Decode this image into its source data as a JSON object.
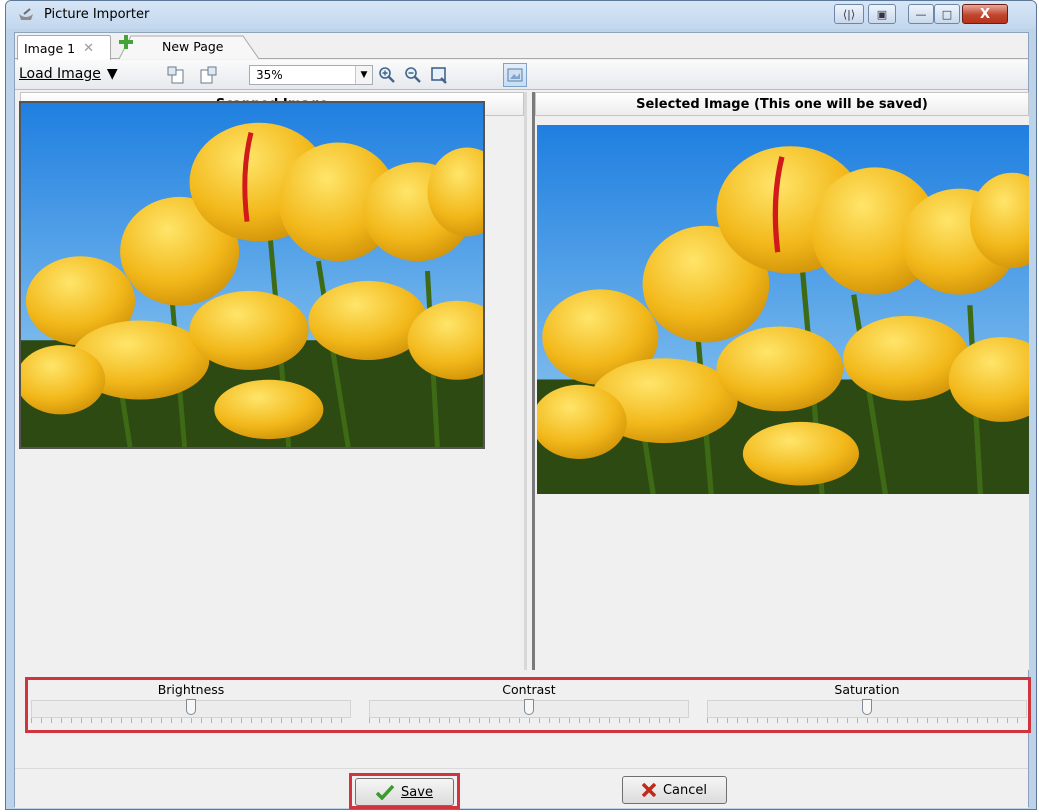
{
  "window": {
    "title": "Picture Importer",
    "controls": [
      "restore-down",
      "minimize",
      "maximize",
      "close"
    ]
  },
  "tabs": [
    {
      "label": "Image 1",
      "close_glyph": "✕"
    },
    {
      "label": "New Page"
    }
  ],
  "toolbar": {
    "load_label": "Load Image",
    "load_arrow": "▼",
    "zoom_value": "35%",
    "icons": [
      "rotate-left-icon",
      "rotate-right-icon",
      "zoom-in-icon",
      "zoom-out-icon",
      "zoom-fit-icon",
      "fit-image-icon"
    ]
  },
  "panes": {
    "left_header": "Scanned Image",
    "right_header": "Selected Image (This one will be saved)"
  },
  "adjustments": {
    "brightness": {
      "label": "Brightness",
      "level": 0.5
    },
    "contrast": {
      "label": "Contrast",
      "level": 0.5
    },
    "saturation": {
      "label": "Saturation",
      "level": 0.5
    }
  },
  "buttons": {
    "save_label": "Save",
    "cancel_label": "Cancel"
  },
  "colors": {
    "highlight": "#d0353f",
    "save_check": "#3a9a2e",
    "cancel_x": "#c02a1a"
  }
}
